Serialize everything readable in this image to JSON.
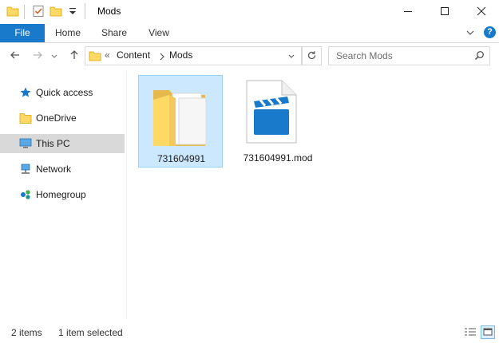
{
  "window": {
    "title": "Mods",
    "controls": {
      "minimize_icon": "minimize-icon",
      "maximize_icon": "maximize-icon",
      "close_icon": "close-icon"
    }
  },
  "ribbon": {
    "tabs": [
      {
        "label": "File",
        "active": true
      },
      {
        "label": "Home"
      },
      {
        "label": "Share"
      },
      {
        "label": "View"
      }
    ],
    "accent": "#1979ca"
  },
  "address": {
    "overflow": "«",
    "crumbs": [
      "Content",
      "Mods"
    ],
    "search_placeholder": "Search Mods"
  },
  "nav_pane": {
    "items": [
      {
        "label": "Quick access",
        "icon": "star-icon"
      },
      {
        "label": "OneDrive",
        "icon": "folder-icon"
      },
      {
        "label": "This PC",
        "icon": "computer-icon",
        "selected": true
      },
      {
        "label": "Network",
        "icon": "network-icon"
      },
      {
        "label": "Homegroup",
        "icon": "homegroup-icon"
      }
    ]
  },
  "content": {
    "items": [
      {
        "name": "731604991",
        "type": "folder",
        "selected": true
      },
      {
        "name": "731604991.mod",
        "type": "file"
      }
    ]
  },
  "status": {
    "item_count": "2 items",
    "selection": "1 item selected"
  },
  "colors": {
    "selection_bg": "#cce8ff",
    "selection_border": "#99d1ff",
    "nav_selected_bg": "#d9d9d9",
    "folder_yellow": "#ffd966",
    "file_blue": "#1979ca"
  }
}
